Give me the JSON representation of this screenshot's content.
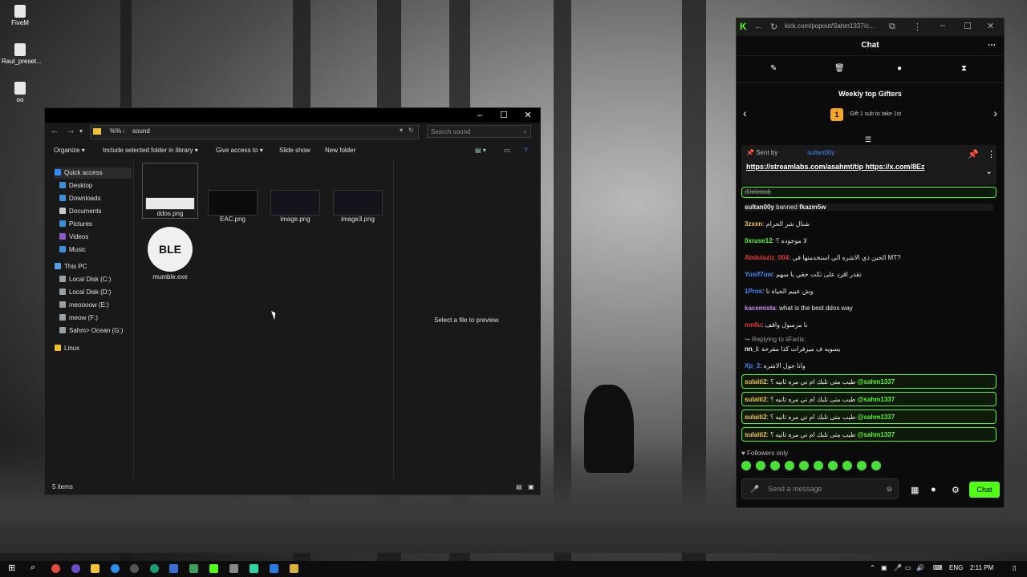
{
  "desktop": {
    "icons": [
      "FiveM",
      "Raul_preset...",
      "oo"
    ]
  },
  "explorer": {
    "path": [
      "%%",
      "sound"
    ],
    "search_placeholder": "Search sound",
    "commands": [
      "Organize",
      "Include selected folder in library",
      "Give access to",
      "Slide show",
      "New folder"
    ],
    "nav": [
      {
        "label": "Quick access",
        "color": "#2f8cff"
      },
      {
        "label": "Desktop",
        "color": "#3b8fd6"
      },
      {
        "label": "Downloads",
        "color": "#3b8fd6"
      },
      {
        "label": "Documents",
        "color": "#c8c8c8"
      },
      {
        "label": "Pictures",
        "color": "#3b8fd6"
      },
      {
        "label": "Videos",
        "color": "#8f5ac8"
      },
      {
        "label": "Music",
        "color": "#3b8fd6"
      },
      {
        "label": "This PC",
        "color": "#5aa0e6"
      },
      {
        "label": "Local Disk (C:)",
        "color": "#9aa0a6"
      },
      {
        "label": "Local Disk (D:)",
        "color": "#9aa0a6"
      },
      {
        "label": "meoooow (E:)",
        "color": "#9aa0a6"
      },
      {
        "label": "meow (F:)",
        "color": "#9aa0a6"
      },
      {
        "label": "Sahm> Ocean (G:)",
        "color": "#9aa0a6"
      },
      {
        "label": "Linux",
        "color": "#f0c030"
      }
    ],
    "files": [
      "ddos.png",
      "EAC.png",
      "image.png",
      "image3.png",
      "mumble.exe"
    ],
    "preview_text": "Select a file to preview.",
    "status": "5 items"
  },
  "kick": {
    "url": "kick.com/popout/Sahm1337/c...",
    "title": "Chat",
    "weekly_title": "Weekly top Gifters",
    "gift_rank": "1",
    "gift_sub": "Gift 1 sub to take 1st",
    "pinned": {
      "sent_by": "Sent by",
      "user": "sultan00y",
      "links": "https://streamlabs.com/asahmt/tip https://x.com/8Ez"
    },
    "deleted": "(Deleted)",
    "ban_line": {
      "user": "sultan00y",
      "text": "banned",
      "target": "fkazm5w"
    },
    "messages": [
      {
        "user": "3zxxn",
        "color": "#f4c542",
        "text": "شنال شر الحرام"
      },
      {
        "user": "0xruse12",
        "color": "#53fc18",
        "text": "لا موجوده ؟"
      },
      {
        "user": "Abdulaziz_004",
        "color": "#e53935",
        "text": "الحين ذي الاشره الي استخدمتها في MT?"
      },
      {
        "user": "Yusif7uw",
        "color": "#3f8cff",
        "text": "تقدر اقرد على تكت حقي يا سهم"
      },
      {
        "user": "1Pros",
        "color": "#3f8cff",
        "text": "وش عبيم الجياة نا"
      },
      {
        "user": "kacemista",
        "color": "#d38cff",
        "text": "what is the best ddos way"
      },
      {
        "user": "nm0u",
        "color": "#e53935",
        "text": "نا مرسول واقف"
      }
    ],
    "reply": {
      "label": "Replying to iiFariis:",
      "user": "nn_i",
      "text": "بسويه ف ميرفرات كذا مفرحة"
    },
    "msg_after_reply": {
      "user": "Xp_3",
      "color": "#3f8cff",
      "text": "وانا جول الاشره"
    },
    "highlights": [
      {
        "user": "sulaiti2",
        "text": "طيب متى تلبك ام تي مره ثانيه ؟",
        "mention": "@sahm1337"
      },
      {
        "user": "sulaiti2",
        "text": "طيب متى تلبك ام تي مره ثانيه ؟",
        "mention": "@sahm1337"
      },
      {
        "user": "sulaiti2",
        "text": "طيب متى تلبك ام تي مره ثانيه ؟",
        "mention": "@sahm1337"
      },
      {
        "user": "sulaiti2",
        "text": "طيب متى تلبك ام تي مره ثانيه ؟",
        "mention": "@sahm1337"
      }
    ],
    "followers_only": "Followers only",
    "input_placeholder": "Send a message",
    "send_label": "Chat",
    "accent": "#53fc18"
  },
  "taskbar": {
    "lang": "ENG",
    "time": "2:11 PM"
  }
}
